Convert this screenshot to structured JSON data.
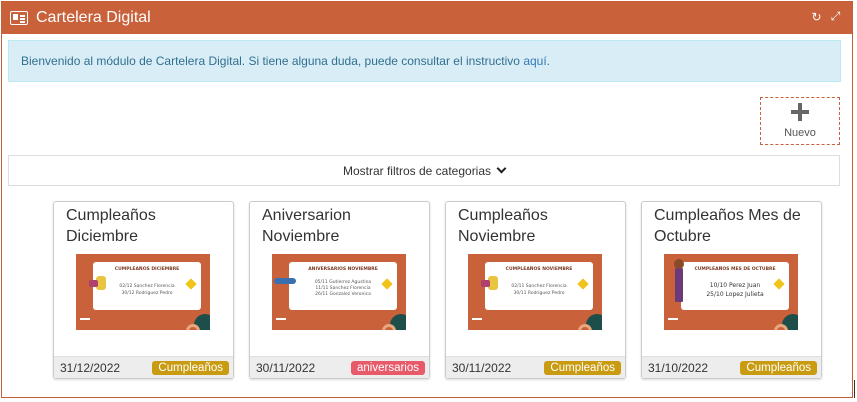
{
  "header": {
    "title": "Cartelera Digital",
    "icons": [
      "newspaper-icon",
      "refresh-icon",
      "expand-icon"
    ]
  },
  "alert": {
    "text": "Bienvenido al módulo de Cartelera Digital. Si tiene alguna duda, puede consultar el instructivo ",
    "link_label": "aquí",
    "suffix": "."
  },
  "new_button": {
    "label": "Nuevo",
    "icon": "plus-icon"
  },
  "filters": {
    "label": "Mostrar filtros de categorias",
    "icon": "chevron-down-icon"
  },
  "cards": [
    {
      "title": "Cumpleaños Diciembre",
      "date": "31/12/2022",
      "badge": "Cumpleaños",
      "badge_color": "#c89b10",
      "slide_title": "CUMPLEAÑOS DICIEMBRE",
      "slide_lines": [
        "02/12 Sanchez Florencia",
        "30/12 Rodriguez Pedro"
      ]
    },
    {
      "title": "Aniversarion Noviembre",
      "date": "30/11/2022",
      "badge": "aniversarios",
      "badge_color": "#e8596a",
      "slide_title": "ANIVERSARIOS NOVIEMBRE",
      "slide_lines": [
        "05/11 Gutierrez Agustina",
        "11/11 Sanchez Florencia",
        "26/11 Gonzalez Veronica"
      ]
    },
    {
      "title": "Cumpleaños Noviembre",
      "date": "30/11/2022",
      "badge": "Cumpleaños",
      "badge_color": "#c89b10",
      "slide_title": "CUMPLEAÑOS NOVIEMBRE",
      "slide_lines": [
        "02/11 Sanchez Florencia",
        "30/11 Rodriguez Pedro"
      ]
    },
    {
      "title": "Cumpleaños Mes de Octubre",
      "date": "31/10/2022",
      "badge": "Cumpleaños",
      "badge_color": "#c89b10",
      "slide_title": "CUMPLEAÑOS MES DE OCTUBRE",
      "slide_lines": [
        "10/10 Perez Juan",
        "25/10 Lopez Julieta"
      ]
    }
  ]
}
